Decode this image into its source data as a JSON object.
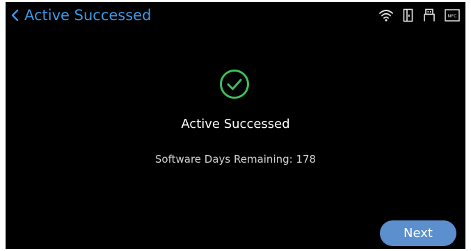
{
  "header": {
    "title": "Active Successed",
    "back_icon": "chevron-left-icon",
    "status_icons": [
      "wifi-icon",
      "door-icon",
      "usb-icon",
      "nfc-icon"
    ],
    "nfc_label": "NFC"
  },
  "main": {
    "status_icon": "check-circle-icon",
    "title": "Active Successed",
    "subtitle": "Software Days Remaining: 178"
  },
  "footer": {
    "next_label": "Next"
  },
  "colors": {
    "background": "#000000",
    "accent": "#3d9ae8",
    "success": "#3fbf5c",
    "button": "#5b8fce"
  }
}
